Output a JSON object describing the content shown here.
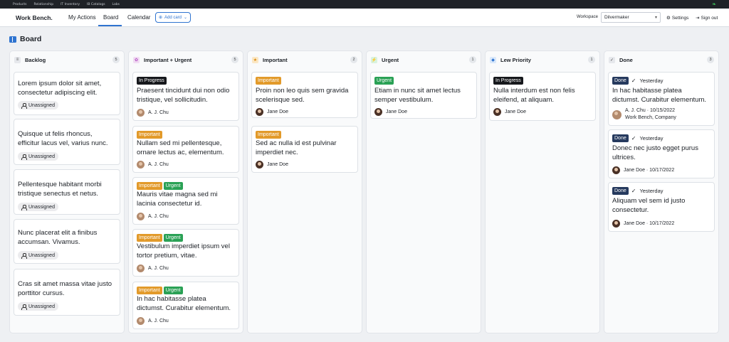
{
  "topbar": {
    "items": [
      "Products",
      "Relationship",
      "IT Inventory",
      "IB Catalogs",
      "Labs"
    ],
    "leaf_icon": "leaf-icon"
  },
  "nav": {
    "brand": "Work Bench.",
    "links": {
      "my_actions": "My Actions",
      "board": "Board",
      "calendar": "Calendar"
    },
    "add_card": "Add card",
    "workspace_label": "Workspace",
    "workspace_value": "Dilvermaker",
    "settings": "Settings",
    "sign_out": "Sign out"
  },
  "colors": {
    "accent": "#2f74d0",
    "in_progress": "#16181c",
    "important": "#e29a2a",
    "urgent": "#2aa155",
    "done": "#263a5e"
  },
  "board": {
    "title": "Board",
    "columns": [
      {
        "title": "Backlog",
        "count": "5",
        "icon": "list-icon",
        "cards": [
          {
            "title": "Lorem ipsum dolor sit amet, consectetur adipiscing elit.",
            "assignee": "Unassigned"
          },
          {
            "title": "Quisque ut felis rhoncus, efficitur lacus vel, varius nunc.",
            "assignee": "Unassigned"
          },
          {
            "title": "Pellentesque habitant morbi tristique senectus et netus.",
            "assignee": "Unassigned"
          },
          {
            "title": "Nunc placerat elit a finibus accumsan. Vivamus.",
            "assignee": "Unassigned"
          },
          {
            "title": "Cras sit amet massa vitae justo porttitor cursus.",
            "assignee": "Unassigned"
          }
        ]
      },
      {
        "title": "Important + Urgent",
        "count": "5",
        "icon": "flower-icon",
        "cards": [
          {
            "tags": [
              "In Progress"
            ],
            "title": "Praesent tincidunt dui non odio tristique, vel sollicitudin.",
            "assignee": "A. J. Chu"
          },
          {
            "tags": [
              "Important"
            ],
            "title": "Nullam sed mi pellentesque, ornare lectus ac, elementum.",
            "assignee": "A. J. Chu"
          },
          {
            "tags": [
              "Important",
              "Urgent"
            ],
            "title": "Mauris vitae magna sed mi lacinia consectetur id.",
            "assignee": "A. J. Chu"
          },
          {
            "tags": [
              "Important",
              "Urgent"
            ],
            "title": "Vestibulum imperdiet ipsum vel tortor pretium, vitae.",
            "assignee": "A. J. Chu"
          },
          {
            "tags": [
              "Important",
              "Urgent"
            ],
            "title": "In hac habitasse platea dictumst. Curabitur elementum.",
            "assignee": "A. J. Chu"
          }
        ]
      },
      {
        "title": "Important",
        "count": "2",
        "icon": "star-icon",
        "cards": [
          {
            "tags": [
              "Important"
            ],
            "title": "Proin non leo quis sem gravida scelerisque sed.",
            "assignee": "Jane Doe"
          },
          {
            "tags": [
              "Important"
            ],
            "title": "Sed ac nulla id est pulvinar imperdiet nec.",
            "assignee": "Jane Doe"
          }
        ]
      },
      {
        "title": "Urgent",
        "count": "1",
        "icon": "bolt-icon",
        "cards": [
          {
            "tags": [
              "Urgent"
            ],
            "title": "Etiam in nunc sit amet lectus semper vestibulum.",
            "assignee": "Jane Doe"
          }
        ]
      },
      {
        "title": "Lew Priority",
        "count": "1",
        "icon": "drop-icon",
        "cards": [
          {
            "tags": [
              "In Progress"
            ],
            "title": "Nulla interdum est non felis eleifend, at aliquam.",
            "assignee": "Jane Doe"
          }
        ]
      },
      {
        "title": "Done",
        "count": "3",
        "icon": "check-icon",
        "cards": [
          {
            "tags": [
              "Done"
            ],
            "when": "Yesterday",
            "title": "In hac habitasse platea dictumst. Curabitur elementum.",
            "meta1": "A. J. Chu · 10/15/2022",
            "meta2": "Work Bench, Company"
          },
          {
            "tags": [
              "Done"
            ],
            "when": "Yesterday",
            "title": "Donec nec justo egget purus ultrices.",
            "meta1": "Jane Doe · 10/17/2022"
          },
          {
            "tags": [
              "Done"
            ],
            "when": "Yesterday",
            "title": "Aliquam vel sem id justo consectetur.",
            "meta1": "Jane Doe · 10/17/2022"
          }
        ]
      }
    ]
  }
}
